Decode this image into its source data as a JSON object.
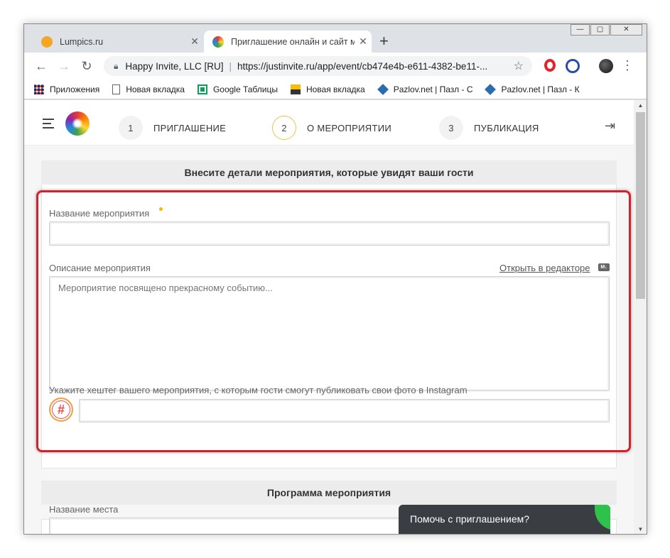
{
  "browser": {
    "tabs": [
      {
        "title": "Lumpics.ru",
        "favicon_color": "#f5a623"
      },
      {
        "title": "Приглашение онлайн и сайт ме",
        "favicon_color": "#6fb86f"
      }
    ],
    "address": {
      "site_name": "Happy Invite, LLC [RU]",
      "url": "https://justinvite.ru/app/event/cb474e4b-e611-4382-be11-..."
    },
    "bookmarks": [
      {
        "label": "Приложения",
        "icon": "apps-grid-icon"
      },
      {
        "label": "Новая вкладка",
        "icon": "page-icon"
      },
      {
        "label": "Google Таблицы",
        "icon": "sheets-icon"
      },
      {
        "label": "Новая вкладка",
        "icon": "image-icon"
      },
      {
        "label": "Pazlov.net | Пазл - С",
        "icon": "puzzle-icon"
      },
      {
        "label": "Pazlov.net | Пазл - К",
        "icon": "puzzle-icon"
      }
    ]
  },
  "steps": [
    {
      "num": "1",
      "label": "ПРИГЛАШЕНИЕ"
    },
    {
      "num": "2",
      "label": "О МЕРОПРИЯТИИ"
    },
    {
      "num": "3",
      "label": "ПУБЛИКАЦИЯ"
    }
  ],
  "details": {
    "header": "Внесите детали мероприятия, которые увидят ваши гости",
    "name_label": "Название мероприятия",
    "name_value": "",
    "description_label": "Описание мероприятия",
    "open_editor": "Открыть в редакторе",
    "md_badge": "M↓",
    "description_placeholder": "Мероприятие посвящено прекрасному событию...",
    "hashtag_label": "Укажите хештег вашего мероприятия, с которым гости смогут публиковать свои фото в Instagram",
    "hashtag_value": ""
  },
  "program": {
    "header": "Программа мероприятия",
    "place_label": "Название места"
  },
  "chat": {
    "text": "Помочь с приглашением?"
  },
  "colors": {
    "highlight": "#d4202a",
    "required_dot": "#f5b800",
    "chat_bg": "#3a3d42",
    "chat_accent": "#2ec24b"
  }
}
